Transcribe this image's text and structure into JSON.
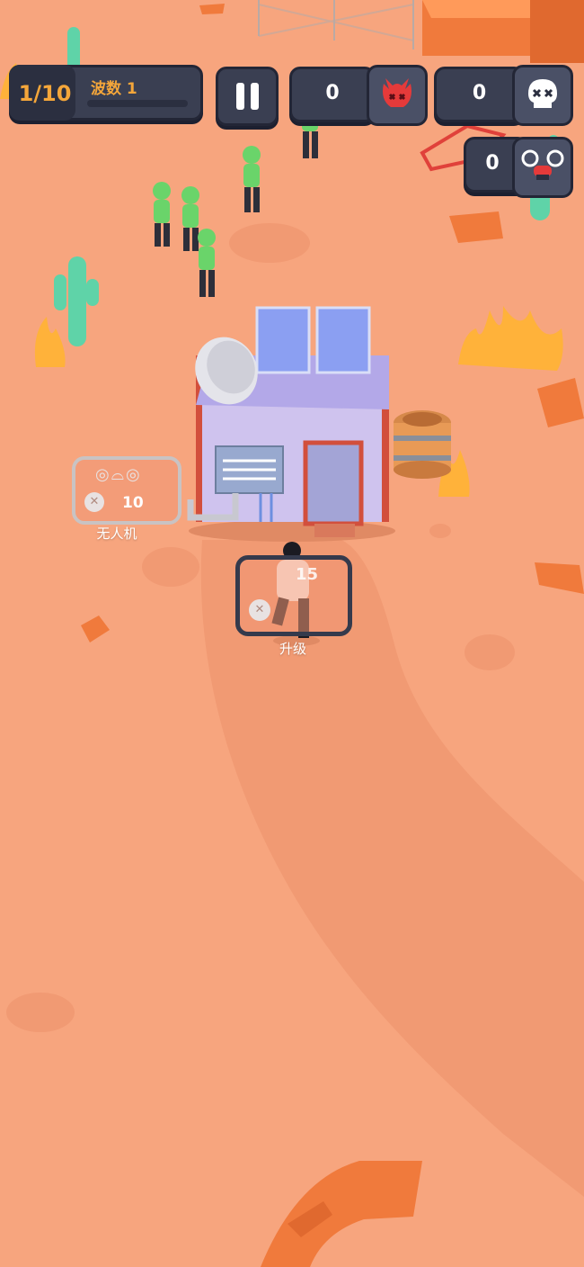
{
  "hud": {
    "wave_progress": "1/10",
    "wave_label": "波数 1",
    "wave_fill": 0.0,
    "pause_icon": "pause-icon",
    "demon_kills": "0",
    "demon_icon": "red-demon-skull-icon",
    "skull_kills": "0",
    "skull_icon": "white-skull-icon",
    "drone_count": "0",
    "drone_icon": "drone-icon"
  },
  "pads": {
    "drone": {
      "label": "无人机",
      "cost": "10",
      "cost_icon": "skull-coin-icon",
      "item_icon": "drone-icon"
    },
    "upgrade": {
      "label": "升级",
      "cost": "15",
      "cost_icon": "skull-coin-icon"
    }
  },
  "colors": {
    "sand": "#f7a57e",
    "path": "#f19a73",
    "rock": "#f07a3c",
    "cactus": "#5fd3a8",
    "zombie": "#6ad46a",
    "hud_bg": "#3a3f52",
    "wave_text": "#f4a63a"
  }
}
